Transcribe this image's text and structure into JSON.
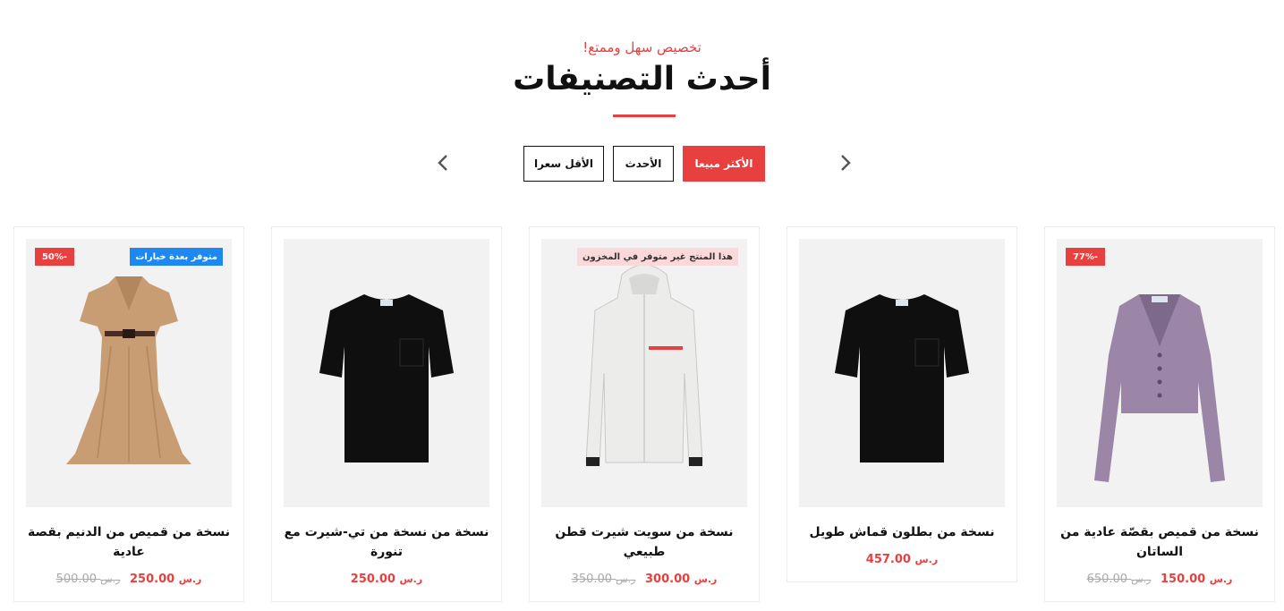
{
  "header": {
    "kicker": "تخصيص سهل وممتع!",
    "title": "أحدث التصنيفات"
  },
  "colors": {
    "accent": "#e8403f",
    "options_badge": "#1e88f0",
    "stock_badge": "#fbd9da"
  },
  "tabs": [
    {
      "label": "الأكثر مبيعا",
      "active": true
    },
    {
      "label": "الأحدث",
      "active": false
    },
    {
      "label": "الأقل سعرا",
      "active": false
    }
  ],
  "currency": "ر.س",
  "products": [
    {
      "name": "نسخة من قميص بقصّة عادية من الساتان",
      "price": "150.00",
      "old_price": "650.00",
      "discount_badge": "-77%",
      "status_badge": "",
      "image_icon": "cardigan-icon"
    },
    {
      "name": "نسخة من بطلون قماش طويل",
      "price": "457.00",
      "old_price": "",
      "discount_badge": "",
      "status_badge": "",
      "image_icon": "tshirt-icon"
    },
    {
      "name": "نسخة من سويت شيرت قطن طبيعي",
      "price": "300.00",
      "old_price": "350.00",
      "discount_badge": "",
      "status_badge": "هذا المنتج غير متوفر في المخزون",
      "image_icon": "jacket-icon"
    },
    {
      "name": "نسخة من نسخة من تي-شيرت مع تنورة",
      "price": "250.00",
      "old_price": "",
      "discount_badge": "",
      "status_badge": "",
      "image_icon": "tshirt-icon"
    },
    {
      "name": "نسخة من قميص من الدنيم بقصة عادية",
      "price": "250.00",
      "old_price": "500.00",
      "discount_badge": "-50%",
      "status_badge": "متوفر بعدة خيارات",
      "image_icon": "dress-icon"
    }
  ]
}
